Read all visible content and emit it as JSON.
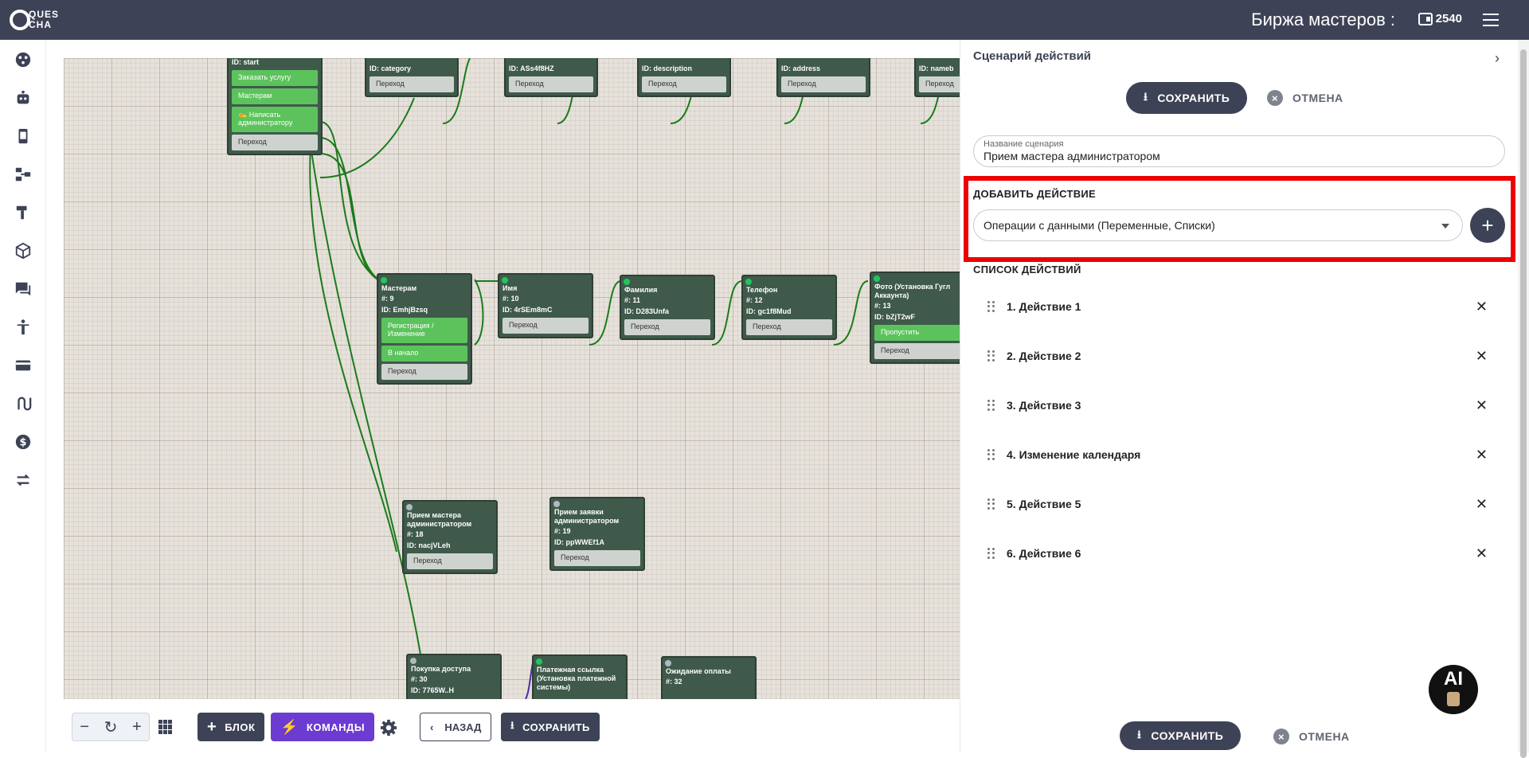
{
  "topbar": {
    "logo_text": "QUES\nCHA",
    "title": "Биржа мастеров :",
    "balance": "2540"
  },
  "sidebar": {
    "icons": [
      "dashboard-icon",
      "robot-icon",
      "phone-icon",
      "hierarchy-icon",
      "hammer-icon",
      "cube-icon",
      "chat-icon",
      "accessibility-icon",
      "credit-card-icon",
      "route-icon",
      "dollar-icon",
      "transfer-icon"
    ]
  },
  "canvas": {
    "nodes": {
      "start": {
        "id_line": "ID: start",
        "ports": [
          "Заказать услугу",
          "Мастерам",
          "✍️ Написать администратору",
          "Переход"
        ]
      },
      "category": {
        "id_line": "ID: category",
        "port": "Переход"
      },
      "n2": {
        "id_line": "ID: ASs4f8HZ",
        "port": "Переход"
      },
      "description": {
        "id_line": "ID: description",
        "port": "Переход"
      },
      "address": {
        "id_line": "ID: address",
        "port": "Переход"
      },
      "nameb": {
        "id_line": "ID: nameb",
        "port": "Переход"
      },
      "masteram": {
        "title": "Мастерам",
        "num": "#: 9",
        "id_line": "ID: EmhjBzsq",
        "ports": [
          "Регистрация / Изменение",
          "В начало",
          "Переход"
        ]
      },
      "imya": {
        "title": "Имя",
        "num": "#: 10",
        "id_line": "ID: 4rSEm8mC",
        "port": "Переход"
      },
      "familiya": {
        "title": "Фамилия",
        "num": "#: 11",
        "id_line": "ID: D283Unfa",
        "port": "Переход"
      },
      "telefon": {
        "title": "Телефон",
        "num": "#: 12",
        "id_line": "ID: gc1f8Mud",
        "port": "Переход"
      },
      "foto": {
        "title": "Фото (Установка Гугл Аккаунта)",
        "num": "#: 13",
        "id_line": "ID: bZjT2wF",
        "ports": [
          "Пропустить",
          "Переход"
        ]
      },
      "priem_mastera": {
        "title": "Прием мастера администратором",
        "num": "#: 18",
        "id_line": "ID: nacjVLeh",
        "port": "Переход"
      },
      "priem_zayavki": {
        "title": "Прием заявки администратором",
        "num": "#: 19",
        "id_line": "ID: ppWWEf1A",
        "port": "Переход"
      },
      "pokupka": {
        "title": "Покупка доступа",
        "num": "#: 30",
        "id_line": "ID: 7765W..H"
      },
      "platezh": {
        "title": "Платежная ссылка (Установка платежной системы)"
      },
      "ozhidanie": {
        "title": "Ожидание оплаты",
        "num": "#: 32"
      }
    }
  },
  "bottombar": {
    "zoom_out": "−",
    "zoom_reset": "↻",
    "zoom_in": "+",
    "block_label": "БЛОК",
    "commands_label": "КОМАНДЫ",
    "back_label": "НАЗАД",
    "save_label": "СОХРАНИТЬ"
  },
  "panel": {
    "header": "Сценарий действий",
    "save_label": "СОХРАНИТЬ",
    "cancel_label": "ОТМЕНА",
    "name_field_label": "Название сценария",
    "name_field_value": "Прием мастера администратором",
    "add_action_title": "ДОБАВИТЬ ДЕЙСТВИЕ",
    "add_action_selected": "Операции с данными (Переменные, Списки)",
    "list_title": "СПИСОК ДЕЙСТВИЙ",
    "actions": [
      "1. Действие 1",
      "2. Действие 2",
      "3. Действие 3",
      "4. Изменение календаря",
      "5. Действие 5",
      "6. Действие 6"
    ],
    "bottom_save_label": "СОХРАНИТЬ",
    "bottom_cancel_label": "ОТМЕНА"
  },
  "ai_button": {
    "label": "AI"
  },
  "colors": {
    "dark": "#3d4256",
    "accent_purple": "#6c3bd1",
    "highlight_red": "#ee0000",
    "node_green": "#3f5a4b",
    "port_green": "#5cc35c"
  }
}
